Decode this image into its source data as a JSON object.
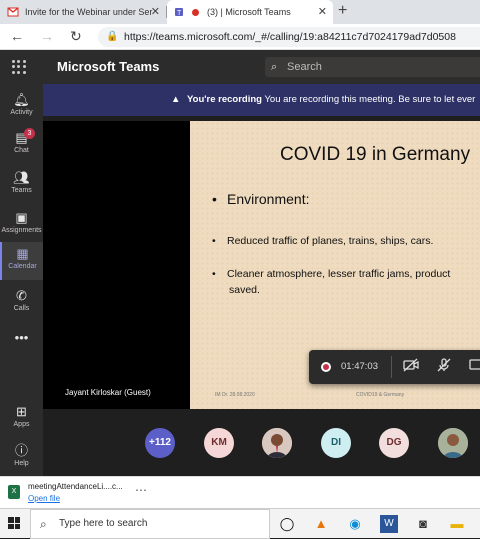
{
  "browser": {
    "tabs": [
      {
        "title": "Invite for the Webinar under Ser",
        "active": false,
        "icon": "gmail-icon"
      },
      {
        "title": "(3) | Microsoft Teams",
        "active": true,
        "icon": "teams-icon"
      }
    ],
    "url": "https://teams.microsoft.com/_#/calling/19:a84211c7d7024179ad7d0508"
  },
  "teams": {
    "app_title": "Microsoft Teams",
    "search_placeholder": "Search",
    "rail": [
      {
        "label": "Activity",
        "icon": "bell-icon"
      },
      {
        "label": "Chat",
        "icon": "chat-icon",
        "badge": "3"
      },
      {
        "label": "Teams",
        "icon": "teams-people-icon"
      },
      {
        "label": "Assignments",
        "icon": "assignments-icon"
      },
      {
        "label": "Calendar",
        "icon": "calendar-icon",
        "active": true
      },
      {
        "label": "Calls",
        "icon": "phone-icon"
      },
      {
        "label": "Apps",
        "icon": "apps-icon"
      },
      {
        "label": "Help",
        "icon": "help-icon"
      }
    ],
    "recording_banner": {
      "bold": "You're recording",
      "text": "You are recording this meeting. Be sure to let ever"
    },
    "participant_name": "Jayant Kirloskar (Guest)",
    "slide": {
      "title": "COVID 19 in Germany",
      "bullet1": "Environment:",
      "bullet2": "Reduced traffic of planes, trains, ships, cars.",
      "bullet3": "Cleaner atmosphere, lesser traffic jams, product",
      "bullet3_cont": "saved.",
      "footer_left": "IM Dr. 28.08.2020",
      "footer_right": "COVID19 & Germany"
    },
    "timer": "01:47:03",
    "participants": {
      "more": "+112",
      "a1": "KM",
      "a2": "DI",
      "a3": "DG"
    },
    "accent": "#5b5fc7"
  },
  "download": {
    "file": "meetingAttendanceLi....c...",
    "action": "Open file"
  },
  "taskbar": {
    "search_placeholder": "Type here to search"
  }
}
